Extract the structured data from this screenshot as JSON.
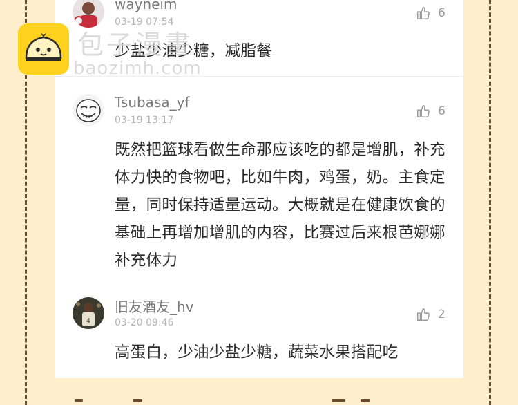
{
  "comments": [
    {
      "username": "wayneim",
      "time": "03-19 07:54",
      "likes": "6",
      "text": "少盐少油少糖，减脂餐",
      "avatar_icon": "user-avatar-photo"
    },
    {
      "username": "Tsubasa_yf",
      "time": "03-19 13:17",
      "likes": "6",
      "text": "既然把篮球看做生命那应该吃的都是增肌，补充体力快的食物吧，比如牛肉，鸡蛋，奶。主食定量，同时保持适量运动。大概就是在健康饮食的基础上再增加增肌的内容，比赛过后来根芭娜娜补充体力",
      "avatar_icon": "smiling-face-avatar"
    },
    {
      "username": "旧友酒友_hv",
      "time": "03-20 09:46",
      "likes": "2",
      "text": "高蛋白，少油少盐少糖，蔬菜水果搭配吃",
      "avatar_icon": "basketball-player-avatar"
    }
  ],
  "watermark": {
    "title": "包子漫畫",
    "url": "baozimh.com",
    "logo_icon": "bun-logo-icon"
  },
  "icons": {
    "like": "thumbs-up-icon"
  },
  "colors": {
    "background": "#ffeecb",
    "border_dash": "#6b4a2c",
    "text_primary": "#2b2b2b",
    "text_secondary": "#7a7a7a",
    "watermark_yellow": "#ffd21e"
  }
}
